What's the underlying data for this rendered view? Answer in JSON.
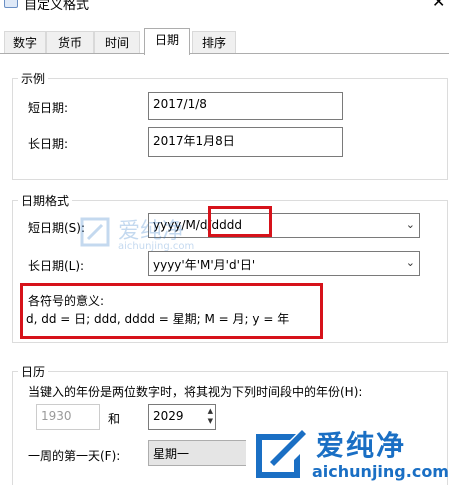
{
  "window": {
    "title": "自定义格式",
    "close_glyph": "✕"
  },
  "tabs": [
    {
      "label": "数字"
    },
    {
      "label": "货币"
    },
    {
      "label": "时间"
    },
    {
      "label": "日期",
      "active": true
    },
    {
      "label": "排序"
    }
  ],
  "example": {
    "title": "示例",
    "short_label": "短日期:",
    "short_value": "2017/1/8",
    "long_label": "长日期:",
    "long_value": "2017年1月8日"
  },
  "date_formats": {
    "title": "日期格式",
    "short_label": "短日期(S):",
    "short_value": "yyyy/M/d/dddd",
    "long_label": "长日期(L):",
    "long_value": "yyyy'年'M'月'd'日'",
    "legend_title": "各符号的意义:",
    "legend_text": "d, dd = 日;  ddd, dddd = 星期;  M = 月;  y = 年"
  },
  "calendar": {
    "title": "日历",
    "two_digit_text": "当键入的年份是两位数字时，将其视为下列时间段中的年份(H):",
    "from_year": "1930",
    "and_label": "和",
    "to_year": "2029",
    "first_day_label": "一周的第一天(F):",
    "first_day_value": "星期一"
  },
  "watermark": {
    "brand": "爱纯净",
    "domain": "aichunjing.com"
  },
  "colors": {
    "highlight_border": "#d6121a",
    "brand_blue": "#1a6fc4"
  },
  "icons": {
    "combo_arrow": "chevron-down-icon",
    "logo": "brand-logo-icon"
  }
}
